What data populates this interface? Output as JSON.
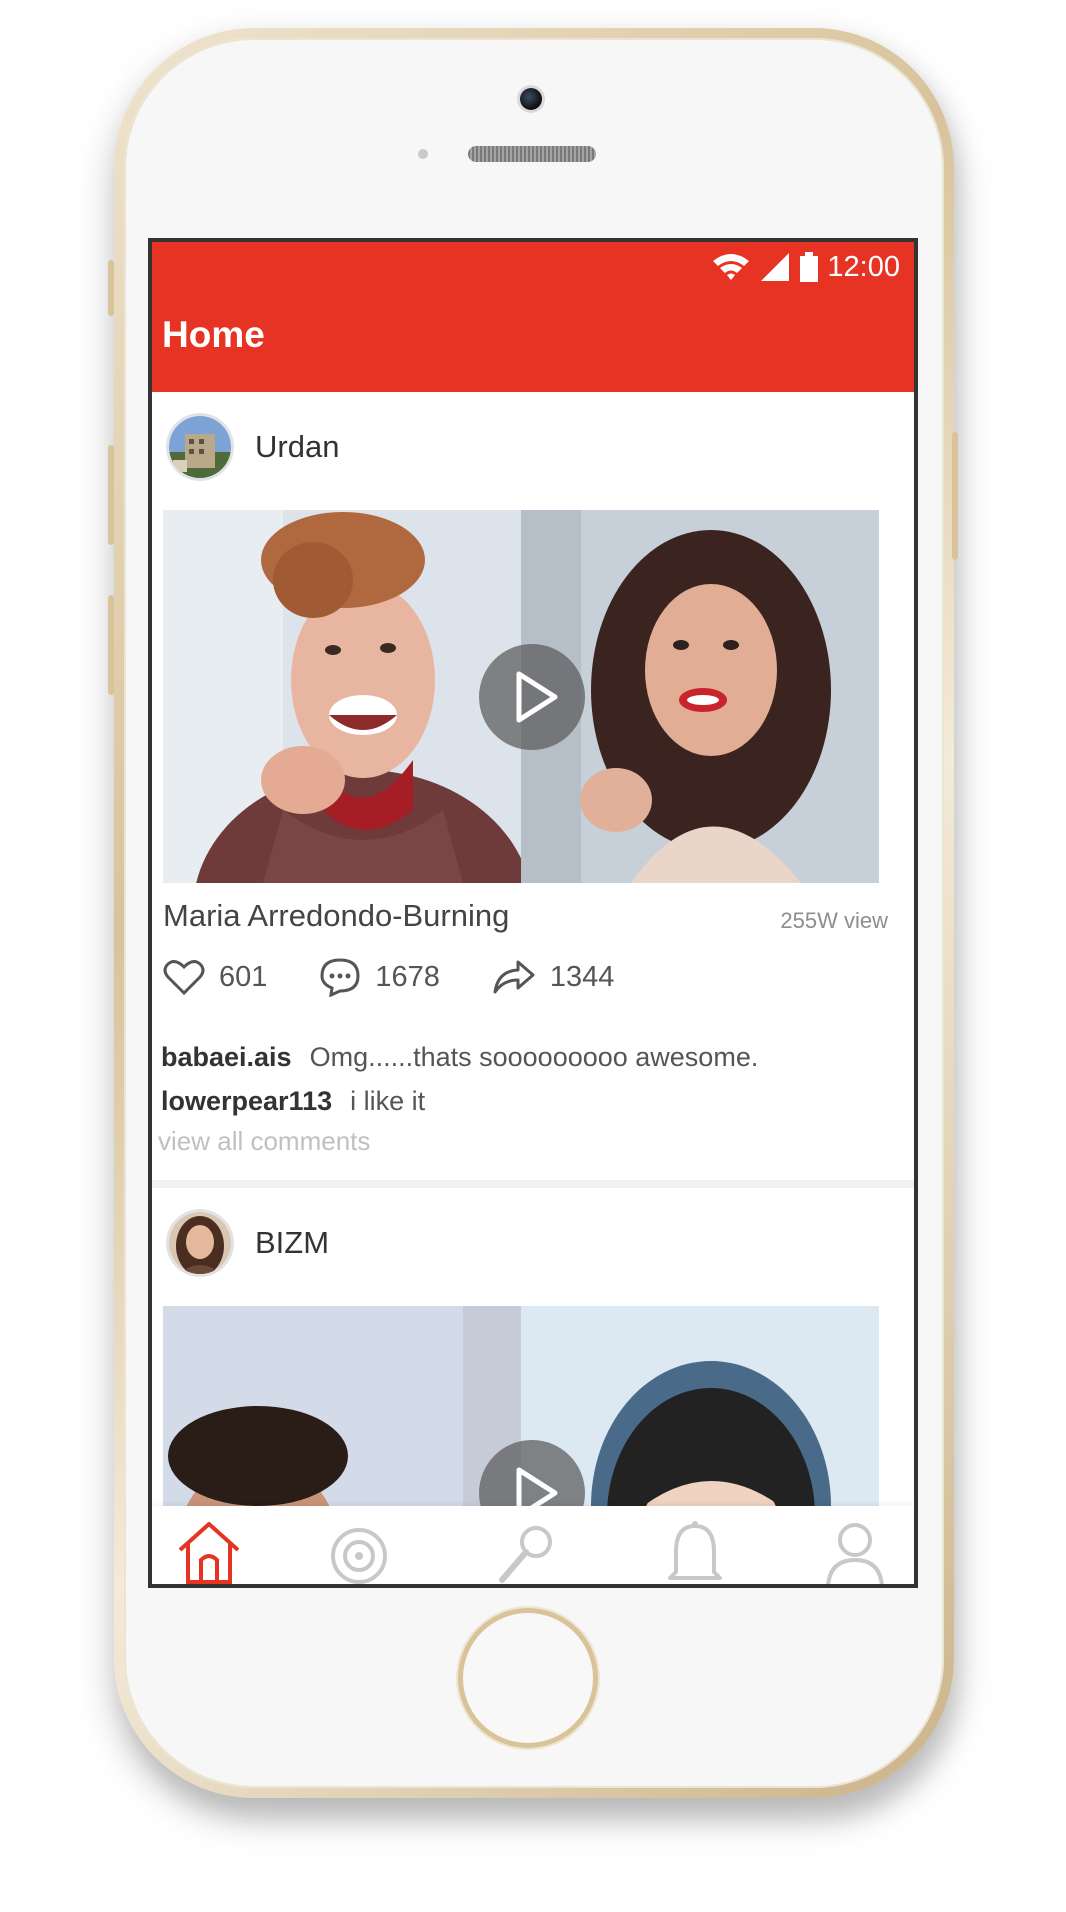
{
  "status_bar": {
    "time": "12:00",
    "icons": [
      "wifi-icon",
      "signal-icon",
      "battery-icon"
    ]
  },
  "app_bar": {
    "title": "Home",
    "color": "#e73323"
  },
  "posts": [
    {
      "author": "Urdan",
      "title": "Maria Arredondo-Burning",
      "views": "255W view",
      "likes": "601",
      "comments_count": "1678",
      "shares": "1344",
      "comments": [
        {
          "user": "babaei.ais",
          "text": "Omg......thats sooooooooo awesome."
        },
        {
          "user": "lowerpear113",
          "text": "i like it"
        }
      ],
      "view_all_label": "view all comments"
    },
    {
      "author": "BIZM"
    }
  ],
  "tab_bar": {
    "items": [
      {
        "icon": "home-icon",
        "active": true
      },
      {
        "icon": "discover-icon",
        "active": false
      },
      {
        "icon": "microphone-icon",
        "active": false
      },
      {
        "icon": "bell-icon",
        "active": false
      },
      {
        "icon": "profile-icon",
        "active": false
      }
    ],
    "active_color": "#e73323",
    "inactive_color": "#c8c8c8"
  }
}
